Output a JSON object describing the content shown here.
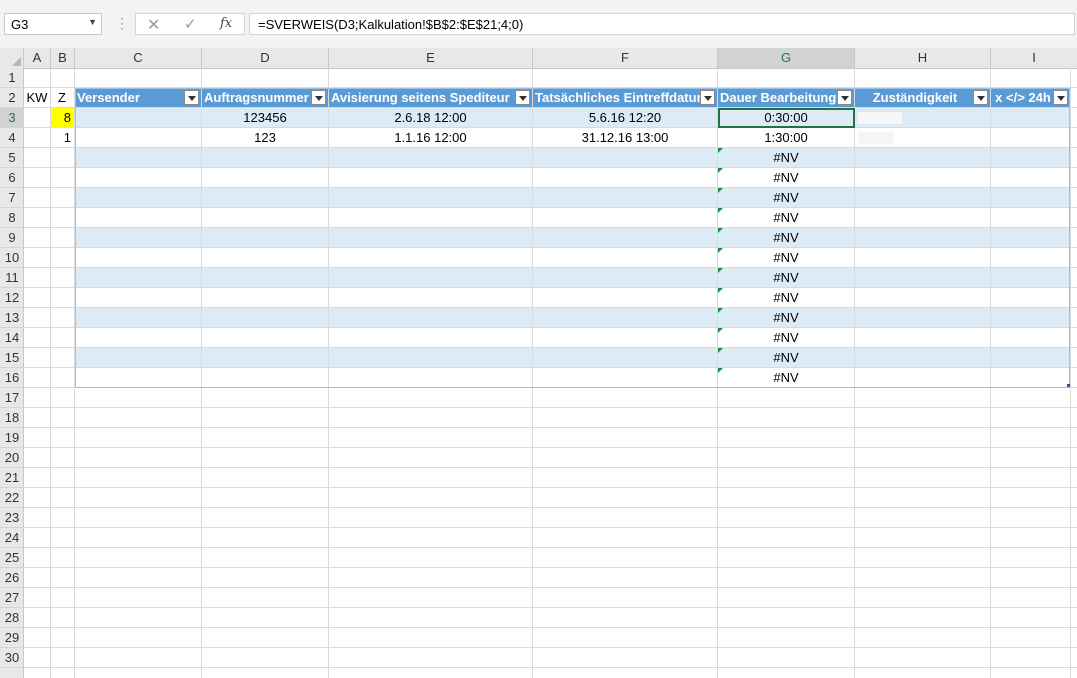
{
  "formula_bar": {
    "name_box": "G3",
    "cancel_icon": "✕",
    "enter_icon": "✓",
    "fx_label": "fx",
    "formula": "=SVERWEIS(D3;Kalkulation!$B$2:$E$21;4;0)"
  },
  "columns": [
    "A",
    "B",
    "C",
    "D",
    "E",
    "F",
    "G",
    "H",
    "I"
  ],
  "rows": [
    "1",
    "2",
    "3",
    "4",
    "5",
    "6",
    "7",
    "8",
    "9",
    "10",
    "11",
    "12",
    "13",
    "14",
    "15",
    "16",
    "17",
    "18",
    "19",
    "20",
    "21",
    "22",
    "23",
    "24",
    "25",
    "26",
    "27",
    "28",
    "29",
    "30"
  ],
  "row2": {
    "a": "KW",
    "b": "Z"
  },
  "table_headers": {
    "c": "Versender",
    "d": "Auftragsnummer",
    "e": "Avisierung seitens Spediteur",
    "f": "Tatsächliches Eintreffdatum",
    "g": "Dauer Bearbeitung",
    "h": "Zuständigkeit",
    "i": "x </> 24h"
  },
  "data_rows": [
    {
      "b": "8",
      "c": "",
      "d": "123456",
      "e": "2.6.18 12:00",
      "f": "5.6.16 12:20",
      "g": "0:30:00",
      "h": "",
      "i": ""
    },
    {
      "b": "1",
      "c": "",
      "d": "123",
      "e": "1.1.16 12:00",
      "f": "31.12.16 13:00",
      "g": "1:30:00",
      "h": "",
      "i": ""
    }
  ],
  "error_value": "#NV",
  "colors": {
    "header_blue": "#5b9bd5",
    "band_blue": "#ddebf7",
    "highlight_yellow": "#ffff00",
    "selection_green": "#217346"
  }
}
